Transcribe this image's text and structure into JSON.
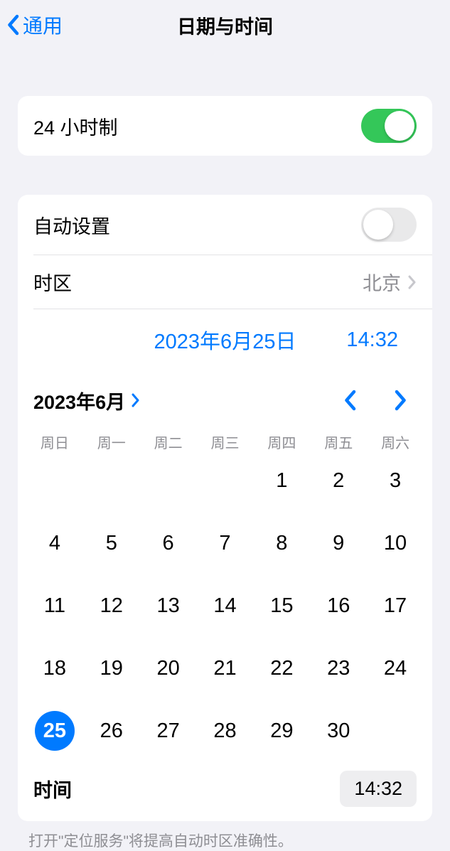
{
  "header": {
    "back_label": "通用",
    "title": "日期与时间"
  },
  "toggle24h": {
    "label": "24 小时制",
    "on": true
  },
  "autoSet": {
    "label": "自动设置",
    "on": false
  },
  "timezone": {
    "label": "时区",
    "value": "北京"
  },
  "selected": {
    "date_display": "2023年6月25日",
    "time_display": "14:32"
  },
  "calendar": {
    "month_label": "2023年6月",
    "weekdays": [
      "周日",
      "周一",
      "周二",
      "周三",
      "周四",
      "周五",
      "周六"
    ],
    "leading_blanks": 4,
    "days": [
      "1",
      "2",
      "3",
      "4",
      "5",
      "6",
      "7",
      "8",
      "9",
      "10",
      "11",
      "12",
      "13",
      "14",
      "15",
      "16",
      "17",
      "18",
      "19",
      "20",
      "21",
      "22",
      "23",
      "24",
      "25",
      "26",
      "27",
      "28",
      "29",
      "30"
    ],
    "selected_day": "25"
  },
  "time_row": {
    "label": "时间",
    "value": "14:32"
  },
  "footer": "打开\"定位服务\"将提高自动时区准确性。"
}
